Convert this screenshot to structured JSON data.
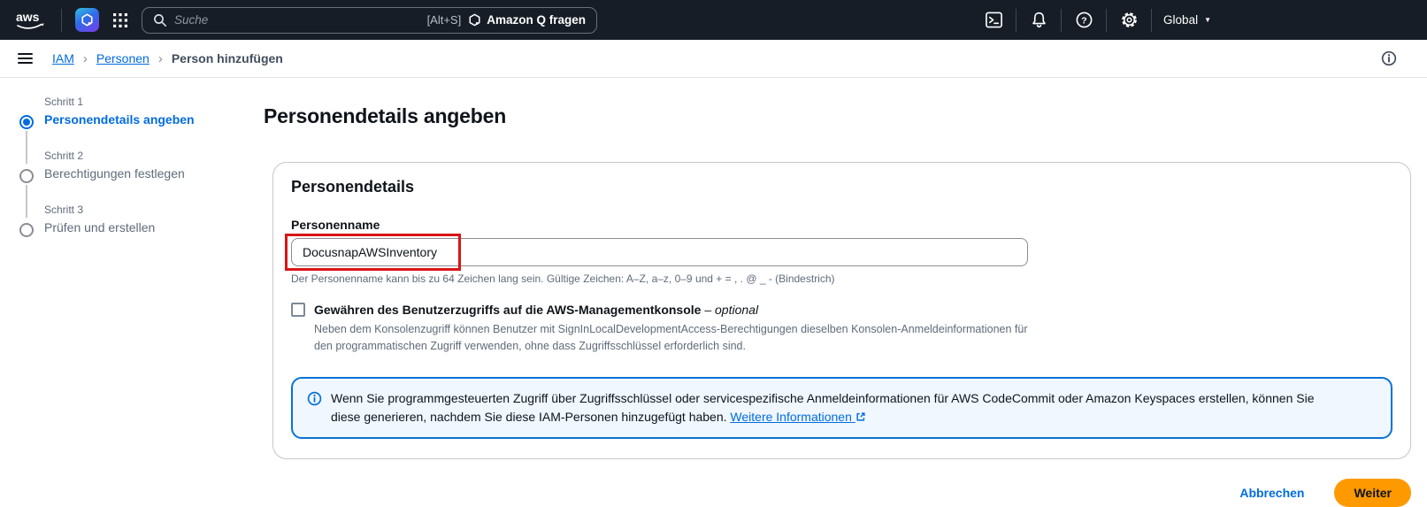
{
  "topbar": {
    "logo": "aws",
    "search_placeholder": "Suche",
    "search_shortcut": "[Alt+S]",
    "q_button_label": "Amazon Q fragen",
    "region": "Global"
  },
  "breadcrumb": {
    "item1": "IAM",
    "item2": "Personen",
    "item3": "Person hinzufügen"
  },
  "steps": {
    "s1_kicker": "Schritt 1",
    "s1_label": "Personendetails angeben",
    "s2_kicker": "Schritt 2",
    "s2_label": "Berechtigungen festlegen",
    "s3_kicker": "Schritt 3",
    "s3_label": "Prüfen und erstellen"
  },
  "main": {
    "title": "Personendetails angeben",
    "card": {
      "title": "Personendetails",
      "name_label": "Personenname",
      "name_value": "DocusnapAWSInventory",
      "name_hint": "Der Personenname kann bis zu 64 Zeichen lang sein. Gültige Zeichen: A–Z, a–z, 0–9 und + = , . @ _ - (Bindestrich)",
      "console_access_label": "Gewähren des Benutzerzugriffs auf die AWS-Managementkonsole",
      "console_access_optional": "– optional",
      "console_access_description": "Neben dem Konsolenzugriff können Benutzer mit SignInLocalDevelopmentAccess-Berechtigungen dieselben Konsolen-Anmeldeinformationen für den programmatischen Zugriff verwenden, ohne dass Zugriffsschlüssel erforderlich sind.",
      "info_text": "Wenn Sie programmgesteuerten Zugriff über Zugriffsschlüssel oder servicespezifische Anmeldeinformationen für AWS CodeCommit oder Amazon Keyspaces erstellen, können Sie diese generieren, nachdem Sie diese IAM-Personen hinzugefügt haben.",
      "info_link": "Weitere Informationen"
    },
    "footer": {
      "cancel_label": "Abbrechen",
      "next_label": "Weiter"
    }
  },
  "icons": {
    "breadcrumb_separator": "›",
    "caret_down": "▼"
  },
  "colors": {
    "topbar_bg": "#161d26",
    "accent_blue": "#006ce0",
    "alert_border": "#0972d3",
    "alert_bg": "#f0f7ff",
    "primary_orange": "#ff9900",
    "highlight_red": "#d91515"
  }
}
